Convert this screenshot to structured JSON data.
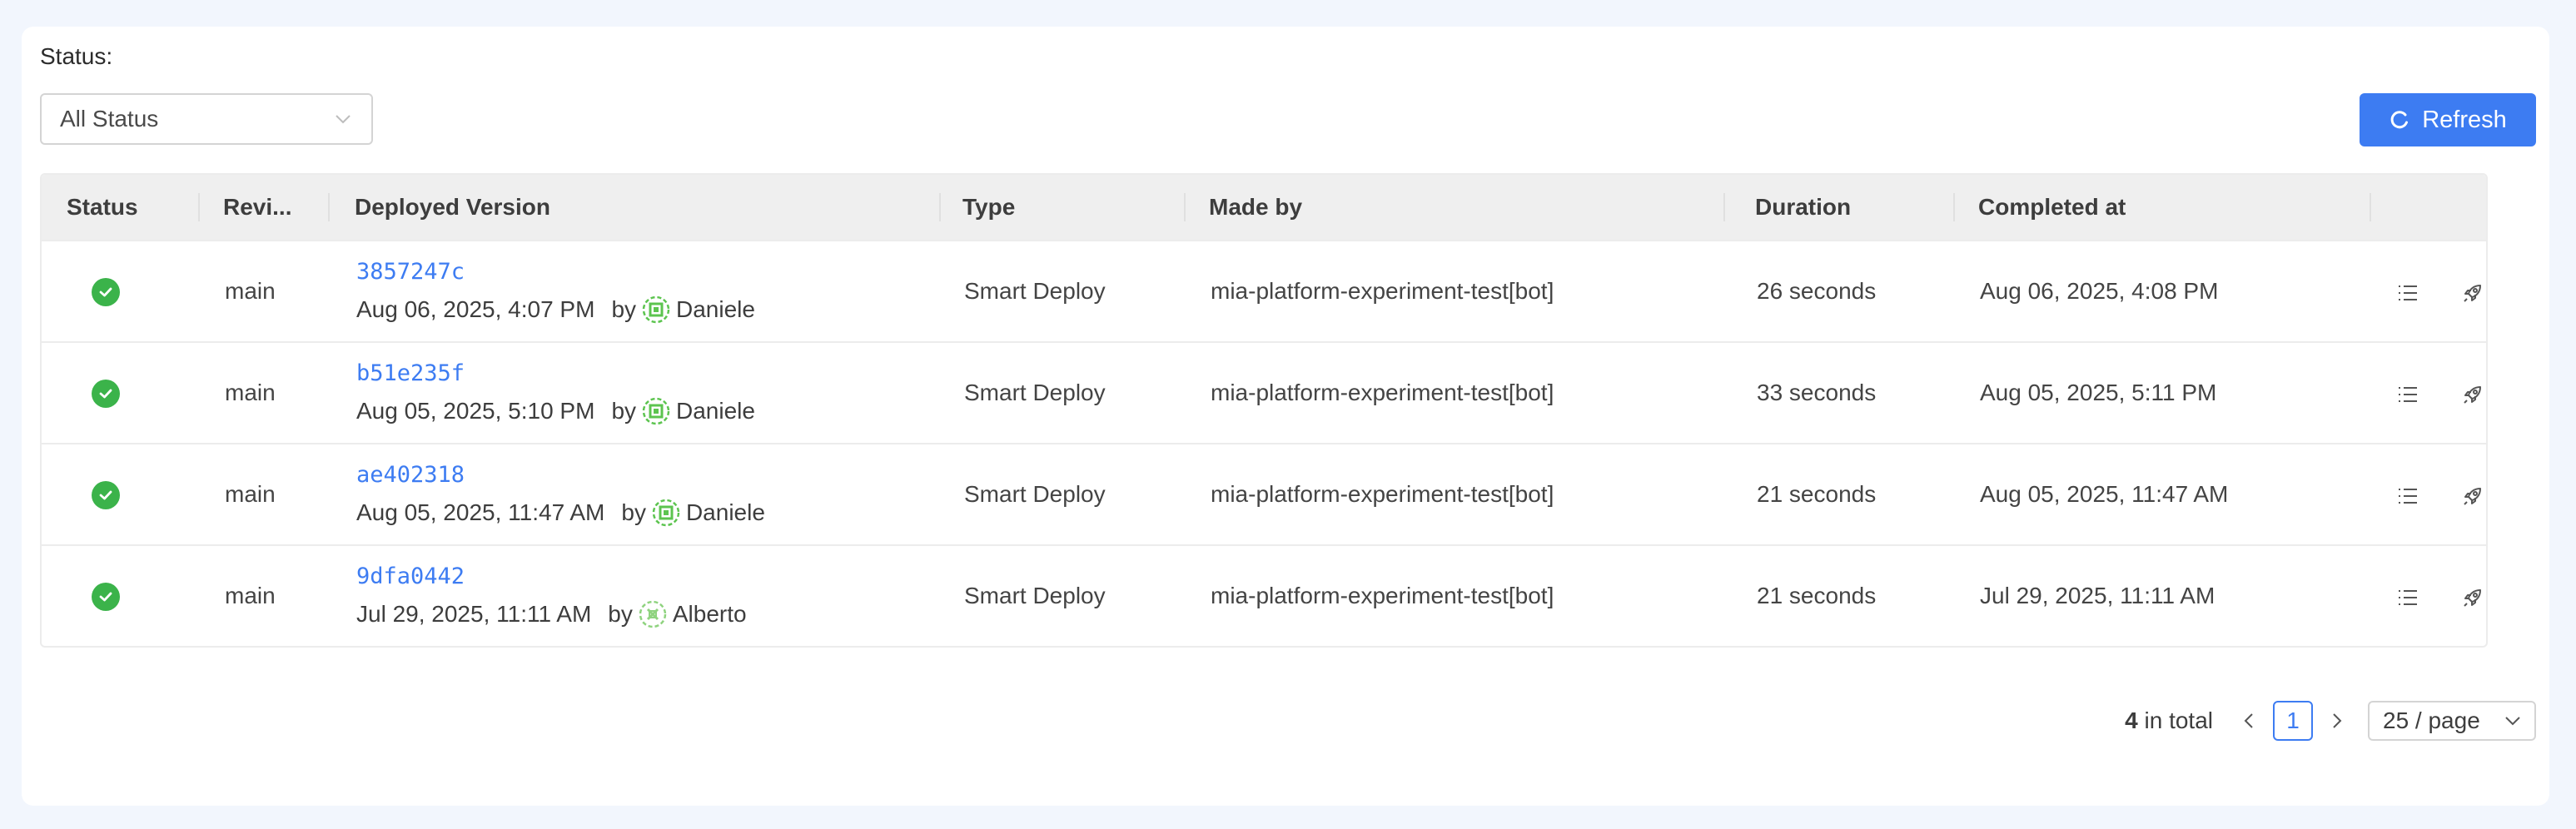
{
  "filter": {
    "label": "Status:",
    "selected": "All Status"
  },
  "toolbar": {
    "refresh_label": "Refresh"
  },
  "table": {
    "headers": [
      "Status",
      "Revi...",
      "Deployed Version",
      "Type",
      "Made by",
      "Duration",
      "Completed at"
    ],
    "rows": [
      {
        "status": "success",
        "revision": "main",
        "commit": "3857247c",
        "deployed_at": "Aug 06, 2025, 4:07 PM",
        "by": "by",
        "author": "Daniele",
        "type": "Smart Deploy",
        "made_by": "mia-platform-experiment-test[bot]",
        "duration": "26 seconds",
        "completed_at": "Aug 06, 2025, 4:08 PM"
      },
      {
        "status": "success",
        "revision": "main",
        "commit": "b51e235f",
        "deployed_at": "Aug 05, 2025, 5:10 PM",
        "by": "by",
        "author": "Daniele",
        "type": "Smart Deploy",
        "made_by": "mia-platform-experiment-test[bot]",
        "duration": "33 seconds",
        "completed_at": "Aug 05, 2025, 5:11 PM"
      },
      {
        "status": "success",
        "revision": "main",
        "commit": "ae402318",
        "deployed_at": "Aug 05, 2025, 11:47 AM",
        "by": "by",
        "author": "Daniele",
        "type": "Smart Deploy",
        "made_by": "mia-platform-experiment-test[bot]",
        "duration": "21 seconds",
        "completed_at": "Aug 05, 2025, 11:47 AM"
      },
      {
        "status": "success",
        "revision": "main",
        "commit": "9dfa0442",
        "deployed_at": "Jul 29, 2025, 11:11 AM",
        "by": "by",
        "author": "Alberto",
        "type": "Smart Deploy",
        "made_by": "mia-platform-experiment-test[bot]",
        "duration": "21 seconds",
        "completed_at": "Jul 29, 2025, 11:11 AM"
      }
    ]
  },
  "pagination": {
    "total_count": "4",
    "total_suffix": "in total",
    "current_page": "1",
    "page_size": "25 / page"
  },
  "colors": {
    "accent": "#3d7cf2",
    "success": "#3bb34a",
    "avatar_green": "#5cc44f"
  },
  "icons": {
    "select_chevron": "chevron-down-icon",
    "refresh": "refresh-icon",
    "status": "check-circle-icon",
    "row_action_1": "list-icon",
    "row_action_2": "rocket-icon",
    "prev": "chevron-left-icon",
    "next": "chevron-right-icon"
  }
}
